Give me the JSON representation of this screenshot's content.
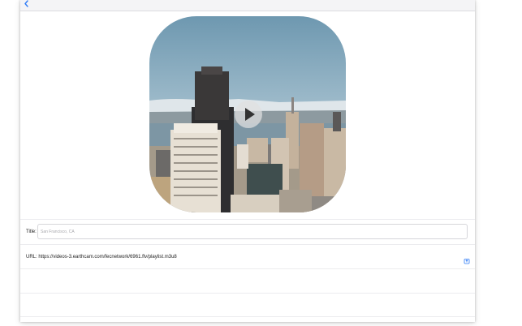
{
  "navbar": {
    "back_icon": "chevron-left-icon"
  },
  "hero": {
    "image": "city-skyline-photo",
    "play_icon": "play-icon"
  },
  "form": {
    "title_label": "Title:",
    "title_placeholder": "San Francisco, CA",
    "title_value": "",
    "url_label": "URL:",
    "url_value": "https://videos-3.earthcam.com/fecnetwork/6961.flv/playlist.m3u8",
    "url_action_icon": "share-icon"
  },
  "colors": {
    "accent": "#2f7cf6",
    "separator": "#ececef"
  }
}
